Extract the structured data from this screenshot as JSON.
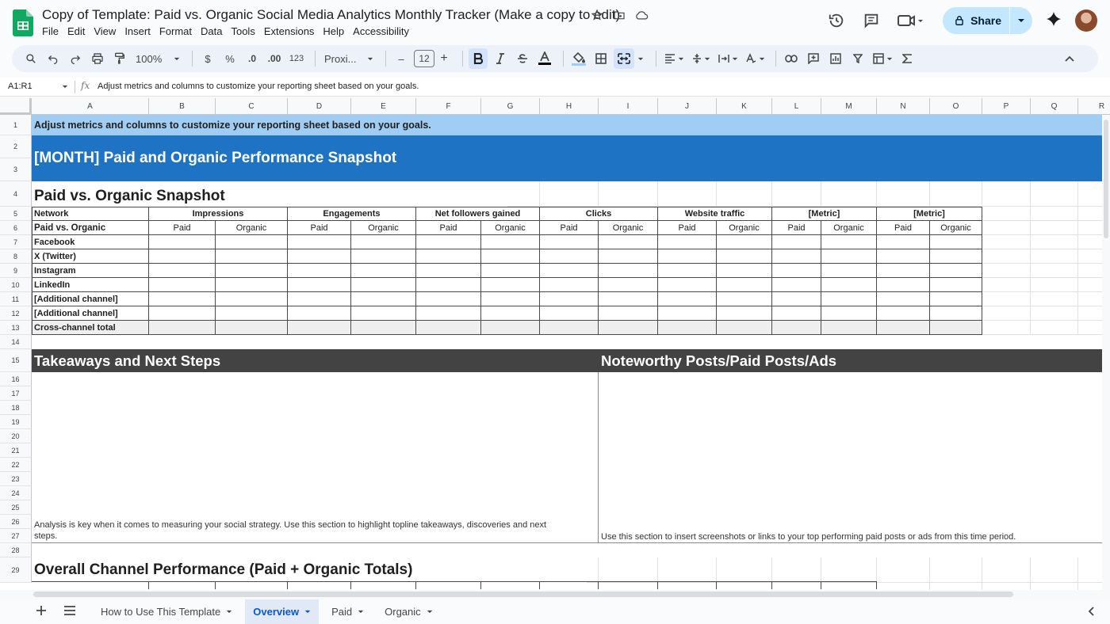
{
  "app": {
    "doc_title": "Copy of Template: Paid vs. Organic Social Media Analytics Monthly Tracker (Make a copy to edit)",
    "menu": [
      "File",
      "Edit",
      "View",
      "Insert",
      "Format",
      "Data",
      "Tools",
      "Extensions",
      "Help",
      "Accessibility"
    ],
    "share_label": "Share"
  },
  "toolbar": {
    "zoom": "100%",
    "currency": "$",
    "percent": "%",
    "dec_decrease": ".0",
    "dec_increase": ".00",
    "number_format": "123",
    "font": "Proxi...",
    "font_size": "12",
    "minus": "–",
    "plus": "+"
  },
  "formula_bar": {
    "name_box": "A1:R1",
    "fx": "fx",
    "content": "Adjust metrics and columns to customize your reporting sheet based on your goals."
  },
  "columns": [
    "A",
    "B",
    "C",
    "D",
    "E",
    "F",
    "G",
    "H",
    "I",
    "J",
    "K",
    "L",
    "M",
    "N",
    "O",
    "P",
    "Q",
    "R"
  ],
  "rows": [
    "1",
    "2",
    "3",
    "4",
    "5",
    "6",
    "7",
    "8",
    "9",
    "10",
    "11",
    "12",
    "13",
    "14",
    "15",
    "16",
    "17",
    "18",
    "19",
    "20",
    "21",
    "22",
    "23",
    "24",
    "25",
    "26",
    "27",
    "28",
    "29"
  ],
  "sheet": {
    "instruction": "Adjust metrics and columns to customize your reporting sheet based on your goals.",
    "banner_title": "[MONTH] Paid and Organic Performance Snapshot",
    "section_title": "Paid vs. Organic Snapshot",
    "table": {
      "network_header": "Network",
      "subheader_label": "Paid vs. Organic",
      "metrics": [
        "Impressions",
        "Engagements",
        "Net followers gained",
        "Clicks",
        "Website traffic",
        "[Metric]",
        "[Metric]"
      ],
      "sub_cols": [
        "Paid",
        "Organic"
      ],
      "networks": [
        "Facebook",
        "X (Twitter)",
        "Instagram",
        "LinkedIn",
        "[Additional channel]",
        "[Additional channel]"
      ],
      "total_label": "Cross-channel total"
    },
    "takeaways_title": "Takeaways and Next Steps",
    "takeaways_hint_1": "Analysis is key when it comes to measuring your social strategy. Use this section to highlight topline takeaways, discoveries and next",
    "takeaways_hint_2": "steps.",
    "posts_title": "Noteworthy Posts/Paid Posts/Ads",
    "posts_hint": "Use this section to insert screenshots or links to your top performing paid posts or ads from this time period.",
    "overall_title": "Overall Channel Performance (Paid + Organic Totals)"
  },
  "sheet_tabs": [
    {
      "label": "How to Use This Template",
      "active": false
    },
    {
      "label": "Overview",
      "active": true
    },
    {
      "label": "Paid",
      "active": false
    },
    {
      "label": "Organic",
      "active": false
    }
  ],
  "colors": {
    "light_blue_band": "#a0cdf4",
    "title_band": "#1f73c4",
    "dark_band": "#434343",
    "total_row": "#efefef",
    "active_tab": "#0b57d0"
  }
}
